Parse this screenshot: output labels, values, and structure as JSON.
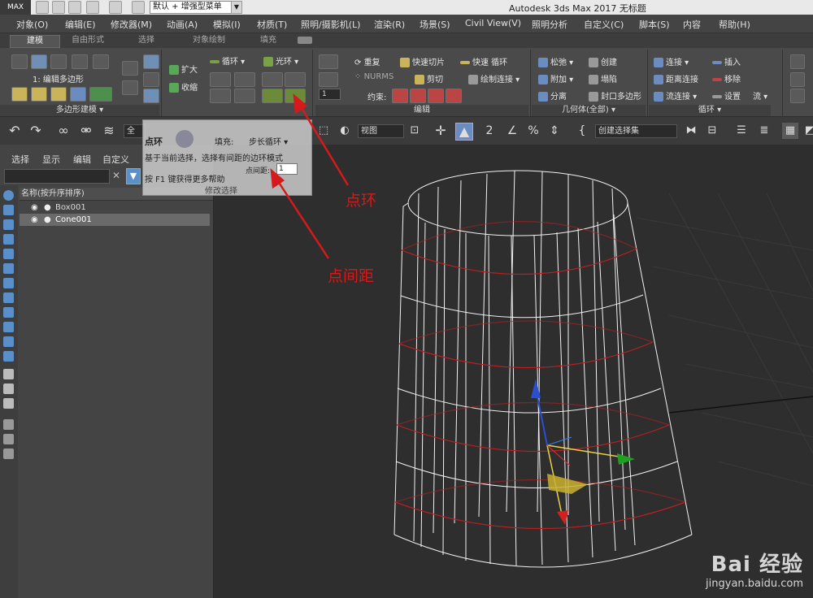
{
  "titlebar": {
    "logo": "MAX",
    "workspace": "默认 + 增强型菜单",
    "title": "Autodesk 3ds Max 2017    无标题"
  },
  "menu": [
    "对象(O)",
    "编辑(E)",
    "修改器(M)",
    "动画(A)",
    "模拟(I)",
    "材质(T)",
    "照明/摄影机(L)",
    "渲染(R)",
    "场景(S)",
    "Civil View(V)",
    "照明分析",
    "自定义(C)",
    "脚本(S)",
    "内容",
    "帮助(H)"
  ],
  "ribbon_tabs": [
    {
      "label": "建模",
      "active": true
    },
    {
      "label": "自由形式",
      "active": false
    },
    {
      "label": "选择",
      "active": false
    },
    {
      "label": "对象绘制",
      "active": false
    },
    {
      "label": "填充",
      "active": false
    }
  ],
  "ribbon": {
    "level_label": "1: 编辑多边形",
    "poly_footer": "多边形建模 ▾",
    "expand": "扩大",
    "shrink": "收缩",
    "loop": "循环 ▾",
    "ring": "光环 ▾",
    "edit": {
      "repeat": "重复",
      "quickslice": "快速切片",
      "quickloop": "快速 循环",
      "nurms": "NURMS",
      "cut": "剪切",
      "paintconnect": "绘制连接 ▾",
      "constraint": "约束:",
      "footer": "编辑"
    },
    "geometry": {
      "relax": "松弛 ▾",
      "create": "创建",
      "attach": "附加 ▾",
      "collapse": "塌陷",
      "detach": "分离",
      "cap": "封口多边形",
      "footer": "几何体(全部) ▾"
    },
    "loops": {
      "connect": "连接 ▾",
      "insert": "插入",
      "distconnect": "距离连接",
      "remove": "移除",
      "flowconnect": "流连接 ▾",
      "settings": "设置",
      "flow": "流 ▾",
      "footer": "循环 ▾"
    },
    "spinner_value": "1"
  },
  "toolbar": {
    "all_combo": "全",
    "view_combo": "视图",
    "selset_combo": "创建选择集"
  },
  "scene_explorer": {
    "tabs": [
      "选择",
      "显示",
      "编辑",
      "自定义"
    ],
    "column_header": "名称(按升序排序)",
    "rows": [
      {
        "name": "Box001",
        "selected": false
      },
      {
        "name": "Cone001",
        "selected": true
      }
    ]
  },
  "tooltip": {
    "title": "点环",
    "fill_label": "填充:",
    "step_loop": "步长循环 ▾",
    "description": "基于当前选择，选择有间距的边环模式",
    "help": "按 F1 键获得更多帮助",
    "dot_gap_label": "点间距:",
    "dot_gap_value": "1",
    "footer": "修改选择"
  },
  "annotations": {
    "dot_ring": "点环",
    "dot_gap": "点间距"
  },
  "watermark": {
    "logo": "Bai 经验",
    "url": "jingyan.baidu.com"
  },
  "colors": {
    "accent_blue": "#5a8fc8",
    "annotation_red": "#d41a1a",
    "ring_red": "#b82020",
    "wire_white": "#f2f2f2",
    "gizmo_yellow": "#e8d24a"
  }
}
